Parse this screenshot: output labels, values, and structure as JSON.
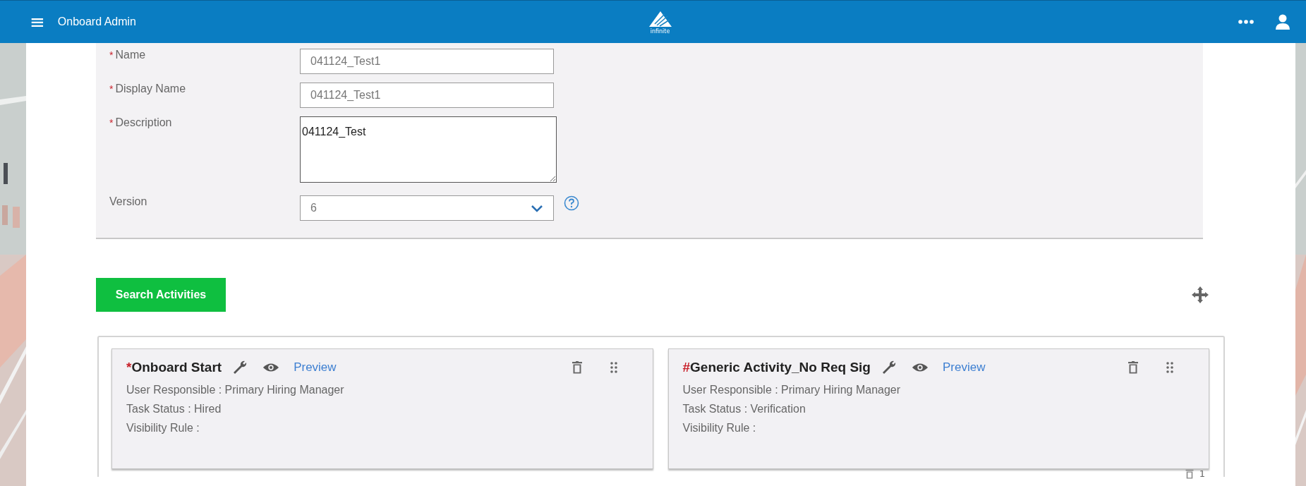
{
  "header": {
    "menu_icon": "≡",
    "title": "Onboard Admin",
    "logo_text": "infinite"
  },
  "form": {
    "fields": [
      {
        "kind": "text",
        "label": "Name",
        "required": true,
        "value": "041124_Test1",
        "disabled": true
      },
      {
        "kind": "text",
        "label": "Display Name",
        "required": true,
        "value": "041124_Test1",
        "disabled": true
      },
      {
        "kind": "textarea",
        "label": "Description",
        "required": true,
        "value": "041124_Test",
        "disabled": false
      },
      {
        "kind": "select",
        "label": "Version",
        "required": false,
        "value": "6",
        "disabled": true,
        "help": true
      }
    ]
  },
  "search_button": "Search Activities",
  "activities": [
    {
      "marker": "*",
      "title": "Onboard Start",
      "link": "Preview",
      "details": [
        "User Responsible : Primary Hiring Manager",
        "Task Status : Hired",
        "Visibility Rule :"
      ]
    },
    {
      "marker": "#",
      "title": "Generic Activity_No Req Sig",
      "link": "Preview",
      "details": [
        "User Responsible : Primary Hiring Manager",
        "Task Status : Verification",
        "Visibility Rule :"
      ]
    }
  ],
  "footer_count": "1"
}
